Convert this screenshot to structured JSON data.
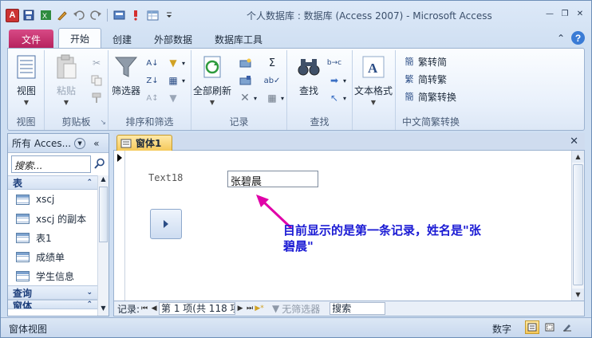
{
  "window": {
    "title": "个人数据库 : 数据库 (Access 2007)  -  Microsoft Access"
  },
  "qat": {
    "app_icon_letter": "A"
  },
  "ribbon_tabs": [
    {
      "label": "文件"
    },
    {
      "label": "开始"
    },
    {
      "label": "创建"
    },
    {
      "label": "外部数据"
    },
    {
      "label": "数据库工具"
    }
  ],
  "ribbon": {
    "views": {
      "label": "视图",
      "group": "视图"
    },
    "clipboard": {
      "paste": "粘贴",
      "group": "剪贴板"
    },
    "sort_filter": {
      "filter": "筛选器",
      "group": "排序和筛选"
    },
    "records": {
      "refresh_all": "全部刷新",
      "sum_symbol": "Σ",
      "group": "记录"
    },
    "find": {
      "find": "查找",
      "group": "查找"
    },
    "text_format": {
      "label": "文本格式"
    },
    "chinese": {
      "to_simplified": "繁转简",
      "to_traditional": "简转繁",
      "convert": "简繁转换",
      "group": "中文简繁转换"
    }
  },
  "nav_pane": {
    "title": "所有 Acces...",
    "search_placeholder": "搜索...",
    "categories": {
      "tables": "表",
      "queries": "查询",
      "forms": "窗体"
    },
    "tables": [
      {
        "label": "xscj"
      },
      {
        "label": "xscj 的副本"
      },
      {
        "label": "表1"
      },
      {
        "label": "成绩单"
      },
      {
        "label": "学生信息"
      }
    ]
  },
  "document": {
    "tab_label": "窗体1",
    "field_label": "Text18",
    "field_value": "张碧晨",
    "annotation": "目前显示的是第一条记录，姓名是\"张碧晨\""
  },
  "record_nav": {
    "label": "记录:",
    "position": "第 1 项(共 118 项",
    "filter": "无筛选器",
    "search": "搜索"
  },
  "status": {
    "left": "窗体视图",
    "mode": "数字"
  }
}
